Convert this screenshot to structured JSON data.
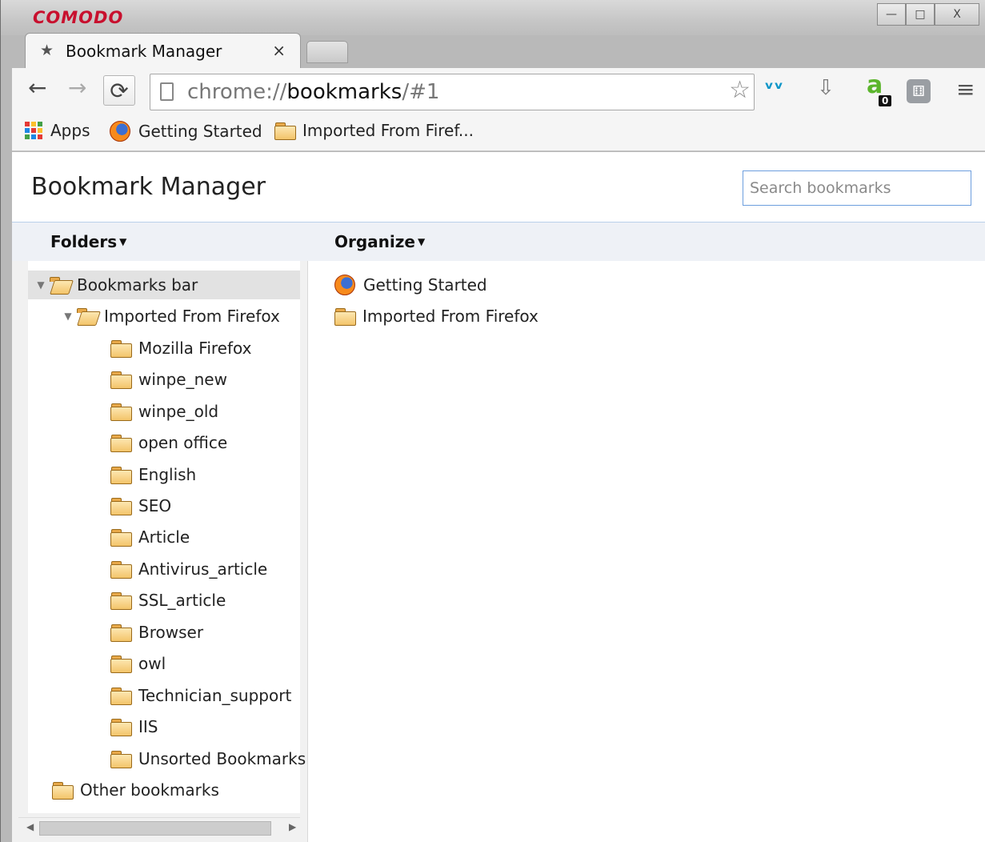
{
  "window": {
    "brand": "COMODO",
    "buttons": [
      "—",
      "□",
      "X"
    ]
  },
  "tab": {
    "title": "Bookmark Manager",
    "close": "×"
  },
  "toolbar": {
    "url_scheme": "chrome://",
    "url_host": "bookmarks",
    "url_path": "/#1",
    "extension_badge": "0"
  },
  "bookmarks_bar": {
    "apps_label": "Apps",
    "items": [
      "Getting Started",
      "Imported From Firef..."
    ]
  },
  "page": {
    "title": "Bookmark Manager",
    "search_placeholder": "Search bookmarks"
  },
  "columns": {
    "folders": "Folders",
    "organize": "Organize"
  },
  "tree": {
    "root": "Bookmarks bar",
    "imported": "Imported From Firefox",
    "children": [
      "Mozilla Firefox",
      "winpe_new",
      "winpe_old",
      "open office",
      "English",
      "SEO",
      "Article",
      "Antivirus_article",
      "SSL_article",
      "Browser",
      "owl",
      "Technician_support",
      "IIS",
      "Unsorted Bookmarks"
    ],
    "other": "Other bookmarks"
  },
  "list": {
    "items": [
      {
        "label": "Getting Started",
        "icon": "firefox-icon"
      },
      {
        "label": "Imported From Firefox",
        "icon": "folder-icon"
      }
    ]
  },
  "colors": {
    "brand": "#c8102e",
    "search_border": "#6d9ede",
    "selected_row": "#e2e2e2"
  }
}
